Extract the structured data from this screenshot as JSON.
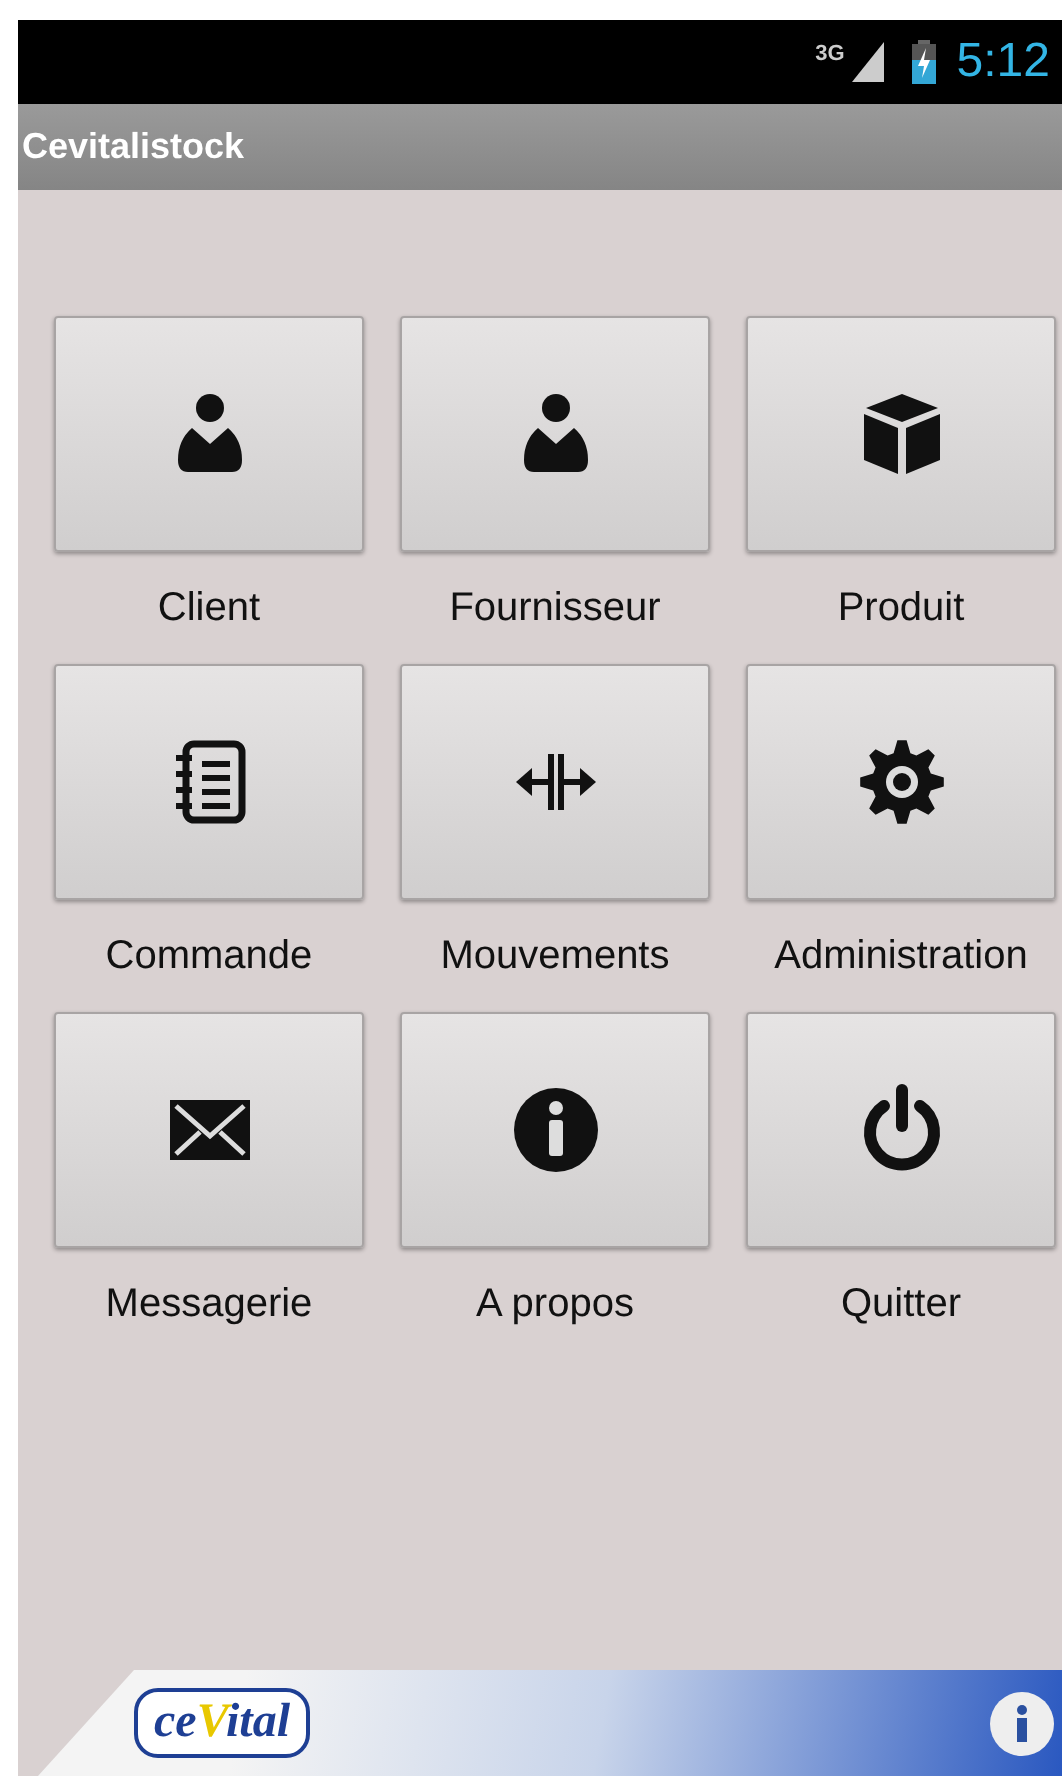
{
  "status_bar": {
    "network": "3G",
    "time": "5:12"
  },
  "app_bar": {
    "title": "Cevitalistock"
  },
  "menu": [
    {
      "label": "Client",
      "kind": "person"
    },
    {
      "label": "Fournisseur",
      "kind": "person"
    },
    {
      "label": "Produit",
      "kind": "cube"
    },
    {
      "label": "Commande",
      "kind": "notebook"
    },
    {
      "label": "Mouvements",
      "kind": "arrows"
    },
    {
      "label": "Administration",
      "kind": "gear"
    },
    {
      "label": "Messagerie",
      "kind": "envelope"
    },
    {
      "label": "A propos",
      "kind": "info"
    },
    {
      "label": "Quitter",
      "kind": "power"
    }
  ],
  "footer": {
    "logo": "ceVital"
  }
}
